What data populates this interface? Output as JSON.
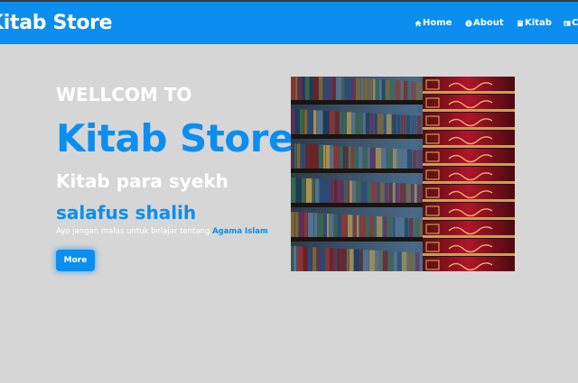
{
  "navbar": {
    "brand": "Kitab Store",
    "items": [
      {
        "label": "Home",
        "icon": "home-icon"
      },
      {
        "label": "About",
        "icon": "info-icon"
      },
      {
        "label": "Kitab",
        "icon": "book-icon"
      },
      {
        "label": "Co",
        "icon": "contact-card-icon"
      }
    ]
  },
  "hero": {
    "line1": "WELLCOM TO",
    "title": "Kitab Store",
    "line3": "Kitab para syekh",
    "line4": "salafus shalih",
    "description_prefix": "Ayo jangan malas untuk belajar tentang ",
    "description_highlight": "Agama Islam",
    "button_label": "More",
    "image_subject": "bookshelf-with-islamic-books-photo"
  },
  "colors": {
    "accent": "#0b8ef0",
    "background": "#d6d6d6",
    "text_light": "#ffffff"
  }
}
